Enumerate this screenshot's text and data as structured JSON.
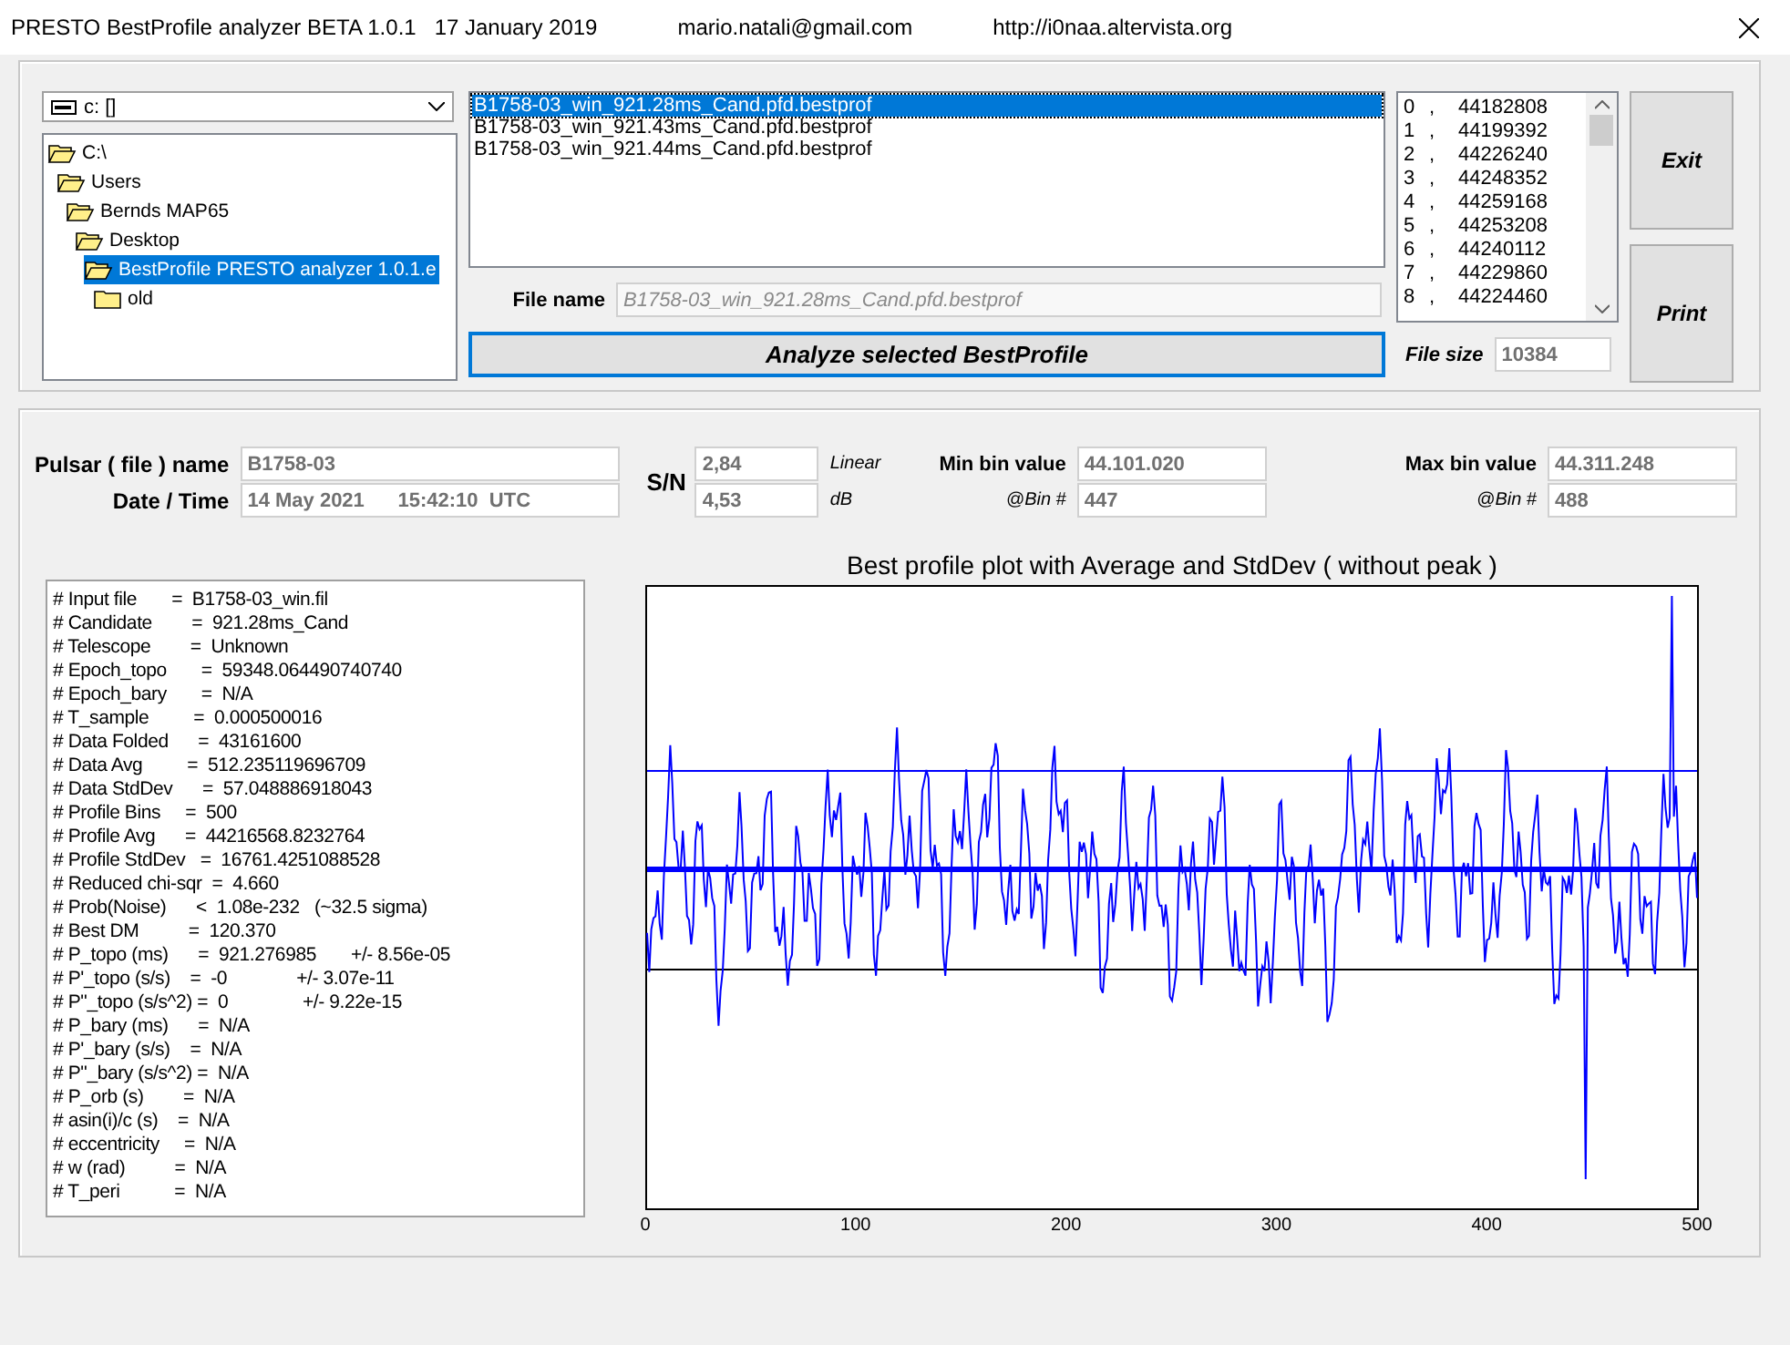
{
  "window": {
    "title": "PRESTO BestProfile analyzer BETA 1.0.1   17 January 2019",
    "email": "mario.natali@gmail.com",
    "website": "http://i0naa.altervista.org"
  },
  "drive": {
    "value": "c: []"
  },
  "folders": [
    {
      "label": "C:\\",
      "selected": false,
      "children": [
        {
          "label": "Users",
          "selected": false,
          "children": [
            {
              "label": "Bernds MAP65",
              "selected": false,
              "children": [
                {
                  "label": "Desktop",
                  "selected": false,
                  "children": [
                    {
                      "label": "BestProfile PRESTO analyzer 1.0.1.e",
                      "selected": true,
                      "children": [
                        {
                          "label": "old",
                          "selected": false
                        }
                      ]
                    }
                  ]
                }
              ]
            }
          ]
        }
      ]
    }
  ],
  "files": [
    {
      "label": "B1758-03_win_921.28ms_Cand.pfd.bestprof",
      "selected": true
    },
    {
      "label": "B1758-03_win_921.43ms_Cand.pfd.bestprof",
      "selected": false
    },
    {
      "label": "B1758-03_win_921.44ms_Cand.pfd.bestprof",
      "selected": false
    }
  ],
  "file_name": {
    "label": "File name",
    "value": "B1758-03_win_921.28ms_Cand.pfd.bestprof"
  },
  "analyze_button": "Analyze selected BestProfile",
  "bins": [
    {
      "index": "0",
      "value": "44182808"
    },
    {
      "index": "1",
      "value": "44199392"
    },
    {
      "index": "2",
      "value": "44226240"
    },
    {
      "index": "3",
      "value": "44248352"
    },
    {
      "index": "4",
      "value": "44259168"
    },
    {
      "index": "5",
      "value": "44253208"
    },
    {
      "index": "6",
      "value": "44240112"
    },
    {
      "index": "7",
      "value": "44229860"
    },
    {
      "index": "8",
      "value": "44224460"
    }
  ],
  "bin_separator": ",",
  "file_size": {
    "label": "File size",
    "value": "10384"
  },
  "buttons": [
    "Exit",
    "Print"
  ],
  "summary": {
    "pulsar_label": "Pulsar ( file ) name",
    "pulsar": "B1758-03",
    "date_label": "Date / Time",
    "date": "14 May 2021      15:42:10  UTC",
    "sn_label": "S/N",
    "sn_linear": "2,84",
    "sn_linear_unit": "Linear",
    "sn_db": "4,53",
    "sn_db_unit": "dB",
    "min_label": "Min bin value",
    "min_value": "44.101.020",
    "min_bin_label": "@Bin #",
    "min_bin": "447",
    "max_label": "Max bin value",
    "max_value": "44.311.248",
    "max_bin_label": "@Bin #",
    "max_bin": "488"
  },
  "stats": [
    "# Input file       =  B1758-03_win.fil",
    "# Candidate        =  921.28ms_Cand",
    "# Telescope        =  Unknown",
    "# Epoch_topo       =  59348.064490740740",
    "# Epoch_bary       =  N/A",
    "# T_sample         =  0.000500016",
    "# Data Folded      =  43161600",
    "# Data Avg         =  512.235119696709",
    "# Data StdDev      =  57.048886918043",
    "# Profile Bins     =  500",
    "# Profile Avg      =  44216568.8232764",
    "# Profile StdDev   =  16761.4251088528",
    "# Reduced chi-sqr  =  4.660",
    "# Prob(Noise)      <  1.08e-232   (~32.5 sigma)",
    "# Best DM          =  120.370",
    "# P_topo (ms)      =  921.276985       +/- 8.56e-05",
    "# P'_topo (s/s)    =  -0              +/- 3.07e-11",
    "# P\"_topo (s/s^2) =  0               +/- 9.22e-15",
    "# P_bary (ms)      =  N/A",
    "# P'_bary (s/s)    =  N/A",
    "# P\"_bary (s/s^2) =  N/A",
    "# P_orb (s)        =  N/A",
    "# asin(i)/c (s)    =  N/A",
    "# eccentricity     =  N/A",
    "# w (rad)          =  N/A",
    "# T_peri           =  N/A"
  ],
  "plot": {
    "title": "Best profile plot with  Average and StdDev ( without peak )",
    "x_ticks": [
      "0",
      "100",
      "200",
      "300",
      "400",
      "500"
    ]
  }
}
